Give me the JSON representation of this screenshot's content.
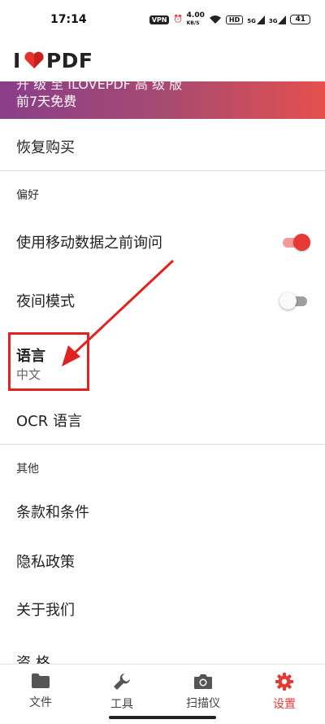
{
  "status_bar": {
    "time": "17:14",
    "vpn": "VPN",
    "speed_value": "4.00",
    "speed_unit": "KB/S",
    "hd": "HD",
    "net1": "5G",
    "net2": "3G",
    "battery": "41"
  },
  "header": {
    "logo_left": "I",
    "logo_right": "PDF"
  },
  "promo": {
    "line1": "开 级 至 ILOVEPDF 高 级 版",
    "line2": "前7天免费"
  },
  "settings": {
    "restore_purchase": "恢复购买",
    "section_preferences": "偏好",
    "ask_mobile_data": "使用移动数据之前询问",
    "night_mode": "夜间模式",
    "language": "语言",
    "language_value": "中文",
    "ocr_language": "OCR 语言",
    "section_other": "其他",
    "terms": "条款和条件",
    "privacy": "隐私政策",
    "about": "关于我们",
    "partial_item": "资 格"
  },
  "toggles": {
    "ask_mobile_data": true,
    "night_mode": false
  },
  "bottom_nav": {
    "files": "文件",
    "tools": "工具",
    "scanner": "扫描仪",
    "settings": "设置"
  },
  "colors": {
    "accent": "#e53935",
    "annotation": "#e0231f"
  }
}
